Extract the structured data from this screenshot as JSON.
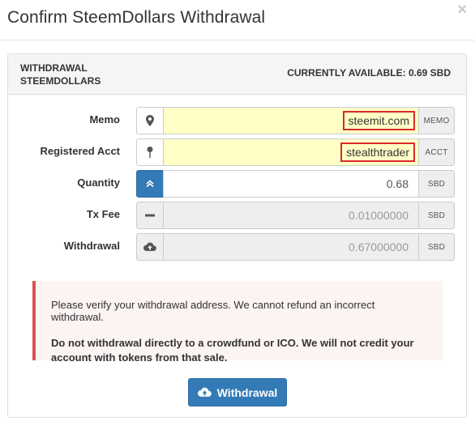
{
  "modal": {
    "title": "Confirm SteemDollars Withdrawal",
    "close_symbol": "×"
  },
  "panel": {
    "heading_left": "WITHDRAWAL STEEMDOLLARS",
    "heading_right": "CURRENTLY AVAILABLE: 0.69 SBD"
  },
  "fields": [
    {
      "label": "Memo",
      "icon": "map-marker-icon",
      "value": "steemit.com",
      "suffix": "MEMO"
    },
    {
      "label": "Registered Acct",
      "icon": "pushpin-icon",
      "value": "stealthtrader",
      "suffix": "ACCT"
    },
    {
      "label": "Quantity",
      "icon": "chevron-double-up-icon",
      "value": "0.68",
      "suffix": "SBD"
    },
    {
      "label": "Tx Fee",
      "icon": "minus-icon",
      "value": "0.01000000",
      "suffix": "SBD"
    },
    {
      "label": "Withdrawal",
      "icon": "cloud-upload-icon",
      "value": "0.67000000",
      "suffix": "SBD"
    }
  ],
  "alert": {
    "line1": "Please verify your withdrawal address. We cannot refund an incorrect withdrawal.",
    "line2": "Do not withdrawal directly to a crowdfund or ICO. We will not credit your account with tokens from that sale."
  },
  "submit": {
    "label": "Withdrawal",
    "icon": "cloud-upload-icon"
  },
  "colors": {
    "primary": "#337ab7",
    "highlight_field": "#ffffc6",
    "alert_border": "#d9534f",
    "alert_bg": "#fcf3f3",
    "annotation_box": "#d92a2a"
  }
}
